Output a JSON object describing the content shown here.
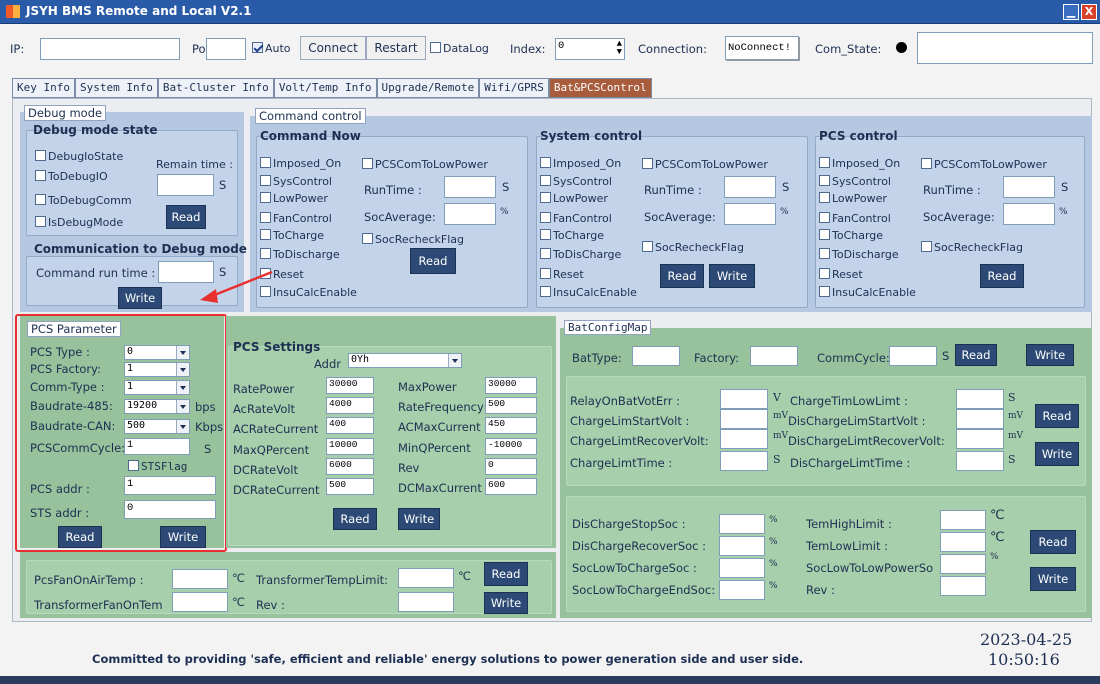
{
  "window": {
    "title": "JSYH BMS Remote and Local V2.1",
    "min": "▁",
    "close": "X"
  },
  "toolbar": {
    "ip_label": "IP:",
    "ip_value": "",
    "port_label": "Port:",
    "port_value": "",
    "auto_label": "Auto",
    "connect": "Connect",
    "restart": "Restart",
    "datalog_label": "DataLog",
    "index_label": "Index:",
    "index_value": "0",
    "connection_label": "Connection:",
    "connection_value": "NoConnect!",
    "com_state_label": "Com_State:",
    "com_state_value": ""
  },
  "tabs": [
    "Key Info",
    "System Info",
    "Bat-Cluster Info",
    "Volt/Temp Info",
    "Upgrade/Remote",
    "Wifi/GPRS",
    "Bat&PCSControl"
  ],
  "debug": {
    "legend": "Debug mode",
    "state_title": "Debug mode state",
    "checks": [
      "DebugIoState",
      "ToDebugIO",
      "ToDebugComm",
      "IsDebugMode"
    ],
    "remain_label": "Remain time :",
    "remain_unit": "S",
    "read": "Read",
    "comm_title": "Communication to Debug mode",
    "cmd_run_label": "Command run time :",
    "cmd_run_unit": "S",
    "write": "Write"
  },
  "command": {
    "legend": "Command control",
    "groups": [
      {
        "title": "Command Now",
        "checks": [
          "Imposed_On",
          "SysControl",
          "LowPower",
          "FanControl",
          "ToCharge",
          "ToDischarge",
          "Reset",
          "InsuCalcEnable"
        ],
        "pcs_com": "PCSComToLowPower",
        "runtime": "RunTime :",
        "runtime_unit": "S",
        "soc_avg": "SocAverage:",
        "soc_unit": "%",
        "soc_recheck": "SocRecheckFlag",
        "read": "Read"
      },
      {
        "title": "System control",
        "checks": [
          "Imposed_On",
          "SysControl",
          "LowPower",
          "FanControl",
          "ToCharge",
          "ToDisCharge",
          "Reset",
          "InsuCalcEnable"
        ],
        "pcs_com": "PCSComToLowPower",
        "runtime": "RunTime :",
        "runtime_unit": "S",
        "soc_avg": "SocAverage:",
        "soc_unit": "%",
        "soc_recheck": "SocRecheckFlag",
        "read": "Read",
        "write": "Write"
      },
      {
        "title": "PCS control",
        "checks": [
          "Imposed_On",
          "SysControl",
          "LowPower",
          "FanControl",
          "ToCharge",
          "ToDischarge",
          "Reset",
          "InsuCalcEnable"
        ],
        "pcs_com": "PCSComToLowPower",
        "runtime": "RunTime :",
        "runtime_unit": "S",
        "soc_avg": "SocAverage:",
        "soc_unit": "%",
        "soc_recheck": "SocRecheckFlag",
        "read": "Read"
      }
    ]
  },
  "pcs_param": {
    "legend": "PCS Parameter",
    "rows": [
      {
        "label": "PCS Type :",
        "value": "0"
      },
      {
        "label": "PCS Factory:",
        "value": "1"
      },
      {
        "label": "Comm-Type :",
        "value": "1"
      },
      {
        "label": "Baudrate-485:",
        "value": "19200",
        "unit": "bps"
      },
      {
        "label": "Baudrate-CAN:",
        "value": "500",
        "unit": "Kbps"
      }
    ],
    "cycle_label": "PCSCommCycle:",
    "cycle_value": "1",
    "cycle_unit": "S",
    "sts_flag": "STSFlag",
    "pcs_addr_label": "PCS addr :",
    "pcs_addr_value": "1",
    "sts_addr_label": "STS addr :",
    "sts_addr_value": "0",
    "read": "Read",
    "write": "Write"
  },
  "pcs_settings": {
    "title": "PCS Settings",
    "addr_label": "Addr",
    "addr_value": "0Yh",
    "left": [
      {
        "label": "RatePower",
        "value": "30000"
      },
      {
        "label": "AcRateVolt",
        "value": "4000"
      },
      {
        "label": "ACRateCurrent",
        "value": "400"
      },
      {
        "label": "MaxQPercent",
        "value": "10000"
      },
      {
        "label": "DCRateVolt",
        "value": "6000"
      },
      {
        "label": "DCRateCurrent",
        "value": "500"
      }
    ],
    "right": [
      {
        "label": "MaxPower",
        "value": "30000"
      },
      {
        "label": "RateFrequency",
        "value": "500"
      },
      {
        "label": "ACMaxCurrent",
        "value": "450"
      },
      {
        "label": "MinQPercent",
        "value": "-10000"
      },
      {
        "label": "Rev",
        "value": "0"
      },
      {
        "label": "DCMaxCurrent",
        "value": "600"
      }
    ],
    "read": "Raed",
    "write": "Write"
  },
  "fan": {
    "a_label": "PcsFanOnAirTemp :",
    "a_unit": "℃",
    "b_label": "TransformerTempLimit:",
    "b_unit": "℃",
    "c_label": "TransformerFanOnTem",
    "c_unit": "℃",
    "d_label": "Rev :",
    "read": "Read",
    "write": "Write"
  },
  "batcfg": {
    "legend": "BatConfigMap",
    "bat_type": "BatType:",
    "factory": "Factory:",
    "comm_cycle": "CommCycle:",
    "cycle_unit": "S",
    "read": "Read",
    "write": "Write",
    "volt_left": [
      {
        "label": "RelayOnBatVotErr :",
        "unit": "V"
      },
      {
        "label": "ChargeLimStartVolt :",
        "unit": "mV"
      },
      {
        "label": "ChargeLimtRecoverVolt:",
        "unit": "mV"
      },
      {
        "label": "ChargeLimtTime :",
        "unit": "S"
      }
    ],
    "volt_right": [
      {
        "label": "ChargeTimLowLimt :",
        "unit": "S"
      },
      {
        "label": "DisChargeLimStartVolt :",
        "unit": "mV"
      },
      {
        "label": "DisChargeLimtRecoverVolt:",
        "unit": "mV"
      },
      {
        "label": "DisChargeLimtTime :",
        "unit": "S"
      }
    ],
    "soc_left": [
      {
        "label": "DisChargeStopSoc :",
        "unit": "%"
      },
      {
        "label": "DisChargeRecoverSoc :",
        "unit": "%"
      },
      {
        "label": "SocLowToChargeSoc :",
        "unit": "%"
      },
      {
        "label": "SocLowToChargeEndSoc:",
        "unit": "%"
      }
    ],
    "soc_right": [
      {
        "label": "TemHighLimit :",
        "unit": "℃"
      },
      {
        "label": "TemLowLimit :",
        "unit": "℃"
      },
      {
        "label": "SocLowToLowPowerSo",
        "unit": "%"
      },
      {
        "label": "Rev :",
        "unit": ""
      }
    ]
  },
  "footer": {
    "slogan": "Committed to providing 'safe, efficient and reliable' energy solutions to power generation side and user side.",
    "date": "2023-04-25",
    "time": "10:50:16"
  }
}
